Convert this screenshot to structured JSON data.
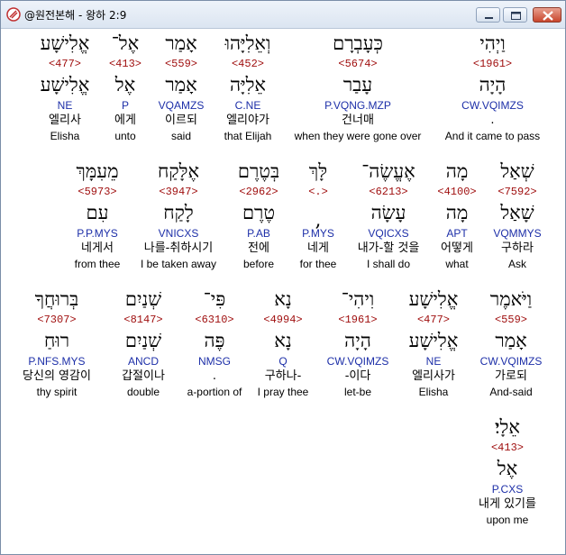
{
  "window": {
    "title": "@원전본해 - 왕하 2:9"
  },
  "rows": [
    [
      {
        "heb1": "וַיְהִי",
        "strong": "<1961>",
        "heb2": "הָיָה",
        "parse": "CW.VQIMZS",
        "kor": ".",
        "eng": "And it came to pass"
      },
      {
        "heb1": "כְּעָבְרָם",
        "strong": "<5674>",
        "heb2": "עָבַר",
        "parse": "P.VQNG.MZP",
        "kor": "건너매",
        "eng": "when they were gone over"
      },
      {
        "heb1": "וְאֵלִיָּהוּ",
        "strong": "<452>",
        "heb2": "אֵלִיָּה",
        "parse": "C.NE",
        "kor": "엘리야가",
        "eng": "that Elijah"
      },
      {
        "heb1": "אָמַר",
        "strong": "<559>",
        "heb2": "אָמַר",
        "parse": "VQAMZS",
        "kor": "이르되",
        "eng": "said"
      },
      {
        "heb1": "אֶל־",
        "strong": "<413>",
        "heb2": "אֶל",
        "parse": "P",
        "kor": "에게",
        "eng": "unto"
      },
      {
        "heb1": "אֱלִישָׁע",
        "strong": "<477>",
        "heb2": "אֱלִישָׁע",
        "parse": "NE",
        "kor": "엘리사",
        "eng": "Elisha"
      }
    ],
    [
      {
        "heb1": "שְׁאַל",
        "strong": "<7592>",
        "heb2": "שָׁאַל",
        "parse": "VQMMYS",
        "kor": "구하라",
        "eng": "Ask"
      },
      {
        "heb1": "מָה",
        "strong": "<4100>",
        "heb2": "מָה",
        "parse": "APT",
        "kor": "어떻게",
        "eng": "what"
      },
      {
        "heb1": "אֶעֱשֶׂה־",
        "strong": "<6213>",
        "heb2": "עָשָׂה",
        "parse": "VQICXS",
        "kor": "내가-할 것을",
        "eng": "I shall do"
      },
      {
        "heb1": "לָּךְ",
        "strong": "<.>",
        "heb2": ",",
        "parse": "P.MYS",
        "kor": "네게",
        "eng": "for thee"
      },
      {
        "heb1": "בְּטֶרֶם",
        "strong": "<2962>",
        "heb2": "טֶרֶם",
        "parse": "P.AB",
        "kor": "전에",
        "eng": "before"
      },
      {
        "heb1": "אֶלָּקַח",
        "strong": "<3947>",
        "heb2": "לָקַח",
        "parse": "VNICXS",
        "kor": "나를-취하시기",
        "eng": "I be taken away"
      },
      {
        "heb1": "מֵעִמָּךְ",
        "strong": "<5973>",
        "heb2": "עִם",
        "parse": "P.P.MYS",
        "kor": "네게서",
        "eng": "from thee"
      }
    ],
    [
      {
        "heb1": "וַיֹּאמֶר",
        "strong": "<559>",
        "heb2": "אָמַר",
        "parse": "CW.VQIMZS",
        "kor": "가로되",
        "eng": "And-said"
      },
      {
        "heb1": "אֱלִישָׁע",
        "strong": "<477>",
        "heb2": "אֱלִישָׁע",
        "parse": "NE",
        "kor": "엘리사가",
        "eng": "Elisha"
      },
      {
        "heb1": "וִיהִי־",
        "strong": "<1961>",
        "heb2": "הָיָה",
        "parse": "CW.VQIMZS",
        "kor": "-이다",
        "eng": "let-be"
      },
      {
        "heb1": "נָא",
        "strong": "<4994>",
        "heb2": "נָא",
        "parse": "Q",
        "kor": "구하나-",
        "eng": "I pray thee"
      },
      {
        "heb1": "פִּי־",
        "strong": "<6310>",
        "heb2": "פֶּה",
        "parse": "NMSG",
        "kor": ".",
        "eng": "a-portion of"
      },
      {
        "heb1": "שְׁנַיִם",
        "strong": "<8147>",
        "heb2": "שְׁנַיִם",
        "parse": "ANCD",
        "kor": "갑절이나",
        "eng": "double"
      },
      {
        "heb1": "בְּרוּחֲךָ",
        "strong": "<7307>",
        "heb2": "רוּחַ",
        "parse": "P.NFS.MYS",
        "kor": "당신의 영감이",
        "eng": "thy spirit"
      }
    ],
    [
      {
        "heb1": "אֵלָי׃",
        "strong": "<413>",
        "heb2": "אֶל",
        "parse": "P.CXS",
        "kor": "내게 있기를",
        "eng": "upon me"
      }
    ]
  ]
}
